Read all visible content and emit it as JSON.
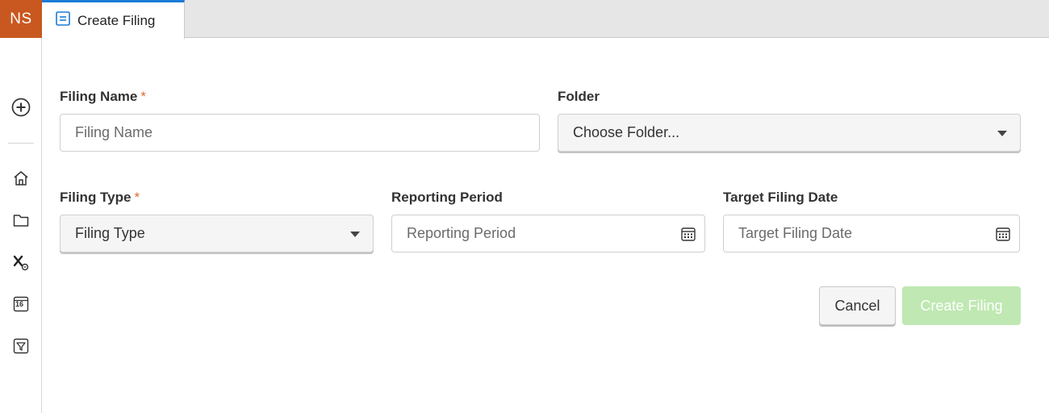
{
  "rail": {
    "avatar_initials": "NS",
    "avatar_color": "#c8581f",
    "items": [
      {
        "icon": "plus-circle-icon"
      },
      {
        "icon": "home-icon"
      },
      {
        "icon": "folder-icon"
      },
      {
        "icon": "tax-icon"
      },
      {
        "icon": "calendar-16-icon",
        "text": "16"
      },
      {
        "icon": "funnel-icon"
      }
    ]
  },
  "tabs": [
    {
      "label": "Create Filing",
      "icon": "form-icon",
      "active": true,
      "accent": "#1b7bd6"
    }
  ],
  "form": {
    "filing_name": {
      "label": "Filing Name",
      "required_mark": "*",
      "placeholder": "Filing Name",
      "value": ""
    },
    "folder": {
      "label": "Folder",
      "selected": "Choose Folder..."
    },
    "filing_type": {
      "label": "Filing Type",
      "required_mark": "*",
      "selected": "Filing Type"
    },
    "reporting_period": {
      "label": "Reporting Period",
      "placeholder": "Reporting Period"
    },
    "target_filing_date": {
      "label": "Target Filing Date",
      "placeholder": "Target Filing Date"
    },
    "actions": {
      "cancel_label": "Cancel",
      "create_label": "Create Filing",
      "create_color": "#bfe8b2"
    }
  }
}
